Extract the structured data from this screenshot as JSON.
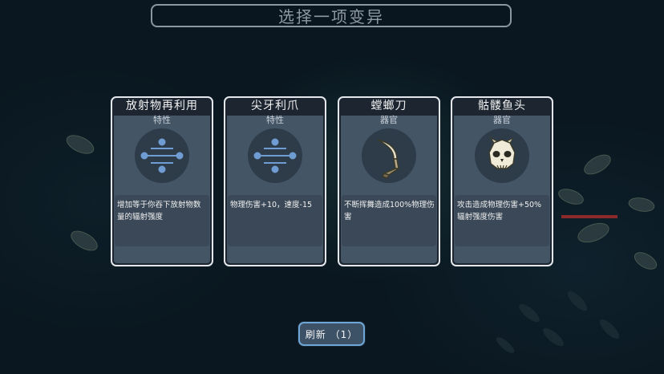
{
  "header": {
    "title": "选择一项变异"
  },
  "cards": [
    {
      "name": "放射物再利用",
      "type": "特性",
      "icon": "trait-icon",
      "description": "增加等于你吞下放射物数量的辐射强度"
    },
    {
      "name": "尖牙利爪",
      "type": "特性",
      "icon": "trait-icon",
      "description": "物理伤害+10，速度-15"
    },
    {
      "name": "螳螂刀",
      "type": "器官",
      "icon": "mantis-blade-icon",
      "description": "不断挥舞造成100%物理伤害"
    },
    {
      "name": "骷髅鱼头",
      "type": "器官",
      "icon": "skull-fish-head-icon",
      "description": "攻击造成物理伤害+50%辐射强度伤害"
    }
  ],
  "footer": {
    "refresh_label": "刷新 （1）"
  },
  "colors": {
    "card_border": "#e4e8ec",
    "card_body": "#445566",
    "desc_panel": "#3a4857",
    "button_fill": "#3d5266",
    "button_border": "#6fa6d6"
  }
}
